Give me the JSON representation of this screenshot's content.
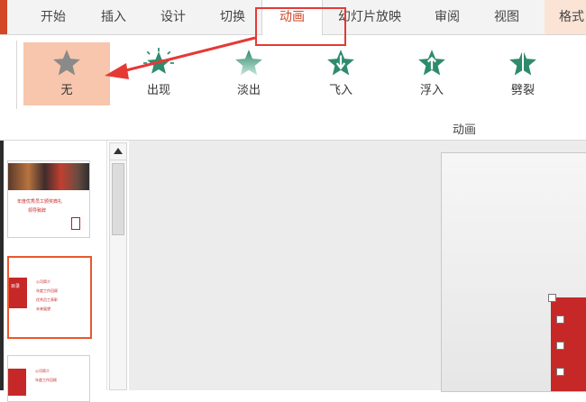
{
  "ribbon_tabs": [
    {
      "label": "开始"
    },
    {
      "label": "插入"
    },
    {
      "label": "设计"
    },
    {
      "label": "切换"
    },
    {
      "label": "动画"
    },
    {
      "label": "幻灯片放映"
    },
    {
      "label": "审阅"
    },
    {
      "label": "视图"
    },
    {
      "label": "格式"
    }
  ],
  "active_tab": "动画",
  "animations": [
    {
      "label": "无",
      "icon": "star-none-icon",
      "color": "#8a8a8a"
    },
    {
      "label": "出现",
      "icon": "star-appear-icon",
      "color": "#2e8b6e"
    },
    {
      "label": "淡出",
      "icon": "star-fade-icon",
      "color": "#7fbfa5"
    },
    {
      "label": "飞入",
      "icon": "star-fly-in-icon",
      "color": "#2e8b6e"
    },
    {
      "label": "浮入",
      "icon": "star-float-in-icon",
      "color": "#2e8b6e"
    },
    {
      "label": "劈裂",
      "icon": "star-split-icon",
      "color": "#2e8b6e"
    }
  ],
  "group_label": "动画",
  "annotation": {
    "color": "#e53935"
  },
  "slides": [
    {
      "title": "年度优秀员工颁奖典礼",
      "subtitle": "领导致辞"
    },
    {
      "header": "目录",
      "items": [
        "公司简介",
        "年度工作回顾",
        "优秀员工表彰",
        "未来展望"
      ]
    },
    {
      "items": [
        "公司简介",
        "年度工作回顾"
      ]
    }
  ],
  "accent_color": "#d24726"
}
